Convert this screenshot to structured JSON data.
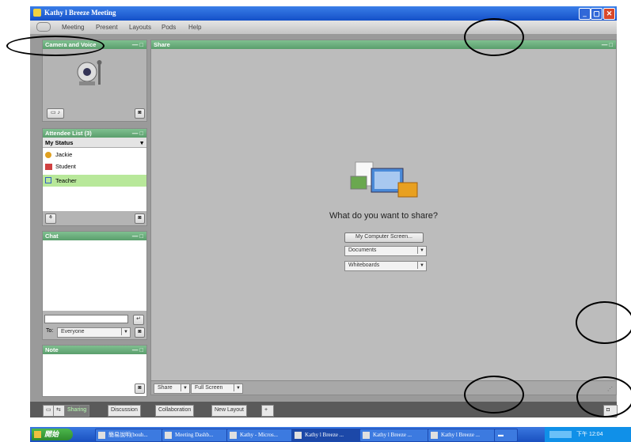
{
  "window": {
    "title": "Kathy l Breeze Meeting",
    "btn_min": "_",
    "btn_max": "▢",
    "btn_close": "✕"
  },
  "menu": {
    "items": [
      "Meeting",
      "Present",
      "Layouts",
      "Pods",
      "Help"
    ]
  },
  "camera": {
    "title": "Camera and Voice",
    "dash": "— □"
  },
  "attendee": {
    "title": "Attendee List (3)",
    "status": "My Status",
    "list": [
      "Jackie",
      "Student",
      "Teacher"
    ]
  },
  "chat": {
    "title": "Chat",
    "to_label": "To:",
    "to_value": "Everyone"
  },
  "note": {
    "title": "Note"
  },
  "share": {
    "title": "Share",
    "prompt": "What do you want to share?",
    "btn_screen": "My Computer Screen...",
    "opt_docs": "Documents",
    "opt_wb": "Whiteboards",
    "bottom_share": "Share",
    "bottom_full": "Full Screen"
  },
  "tabs": [
    "Sharing",
    "Discussion",
    "Collaboration",
    "New Layout"
  ],
  "taskbar": {
    "start": "開始",
    "items": [
      "簡易說明(bouh...",
      "Meeting Dashb...",
      "Kathy - Micros...",
      "Kathy l Breeze ...",
      "Kathy l Breeze ...",
      "Kathy l Breeze ..."
    ],
    "clock": "下午 12:04"
  }
}
